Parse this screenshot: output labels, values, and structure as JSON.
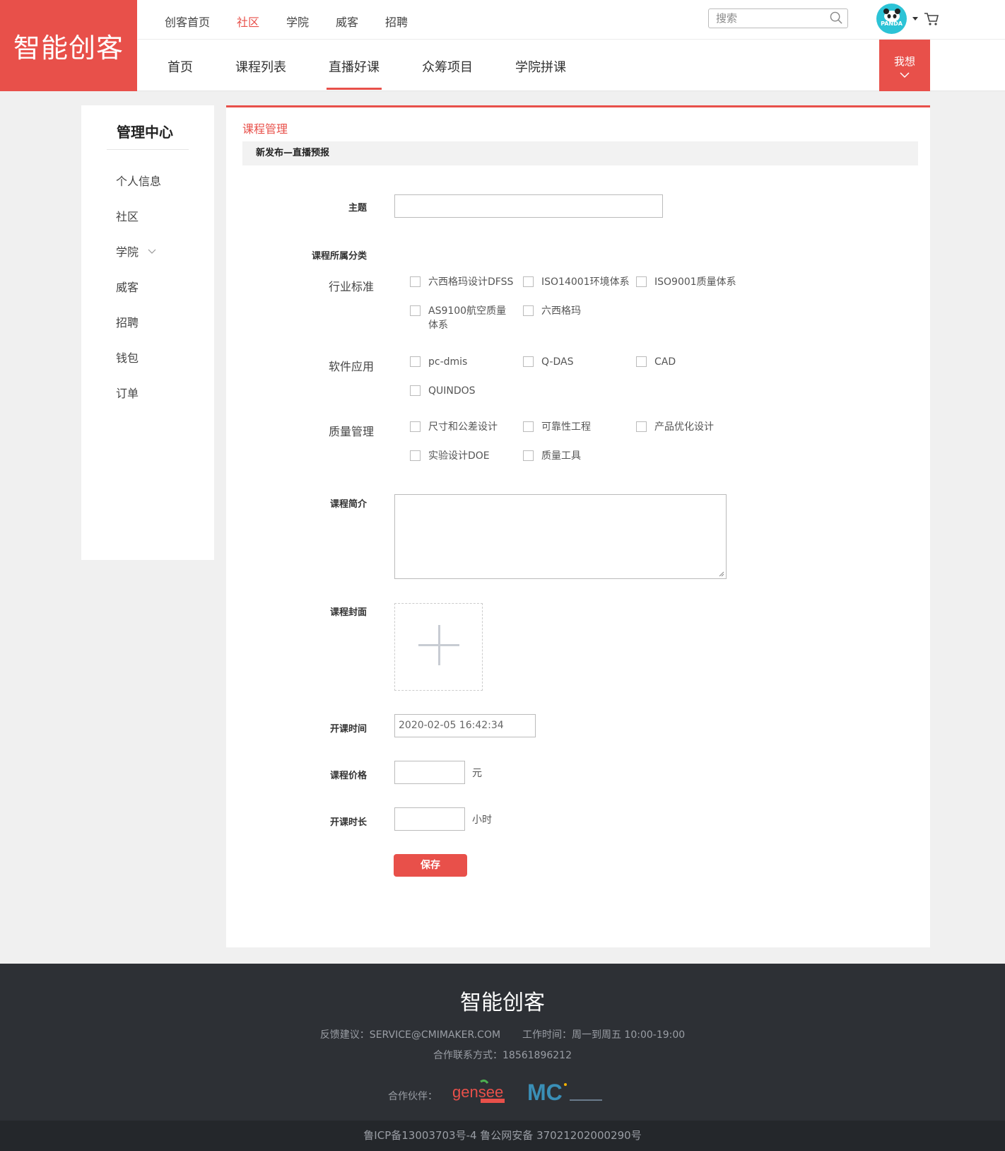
{
  "brand": {
    "logo_text": "智能创客"
  },
  "top_nav": [
    "创客首页",
    "社区",
    "学院",
    "威客",
    "招聘"
  ],
  "search": {
    "placeholder": "搜索"
  },
  "avatar": {
    "text": "PANDA"
  },
  "sub_nav": [
    "首页",
    "课程列表",
    "直播好课",
    "众筹项目",
    "学院拼课"
  ],
  "want_button": "我想",
  "sidebar": {
    "title": "管理中心",
    "items": [
      "个人信息",
      "社区",
      "学院",
      "威客",
      "招聘",
      "钱包",
      "订单"
    ]
  },
  "main": {
    "breadcrumb": "课程管理",
    "section_title": "新发布—直播预报",
    "labels": {
      "topic": "主题",
      "category": "课程所属分类",
      "intro": "课程简介",
      "cover": "课程封面",
      "start_time": "开课时间",
      "price": "课程价格",
      "duration": "开课时长"
    },
    "groups": [
      {
        "label": "行业标准",
        "options": [
          "六西格玛设计DFSS",
          "ISO14001环境体系",
          "ISO9001质量体系",
          "AS9100航空质量体系",
          "六西格玛"
        ]
      },
      {
        "label": "软件应用",
        "options": [
          "pc-dmis",
          "Q-DAS",
          "CAD",
          "QUINDOS"
        ]
      },
      {
        "label": "质量管理",
        "options": [
          "尺寸和公差设计",
          "可靠性工程",
          "产品优化设计",
          "实验设计DOE",
          "质量工具"
        ]
      }
    ],
    "start_time_value": "2020-02-05 16:42:34",
    "price_unit": "元",
    "duration_unit": "小时",
    "save_label": "保存"
  },
  "footer": {
    "logo_text": "智能创客",
    "feedback": "反馈建议：SERVICE@CMIMAKER.COM",
    "hours": "工作时间：周一到周五 10:00-19:00",
    "contact": "合作联系方式：18561896212",
    "partners_label": "合作伙伴：",
    "partners": [
      "gensee",
      "MC"
    ],
    "icp": "鲁ICP备13003703号-4 鲁公网安备 37021202000290号"
  },
  "colors": {
    "accent": "#e8504a",
    "footer_bg": "#2d3035",
    "avatar_bg": "#2cc3d6"
  }
}
